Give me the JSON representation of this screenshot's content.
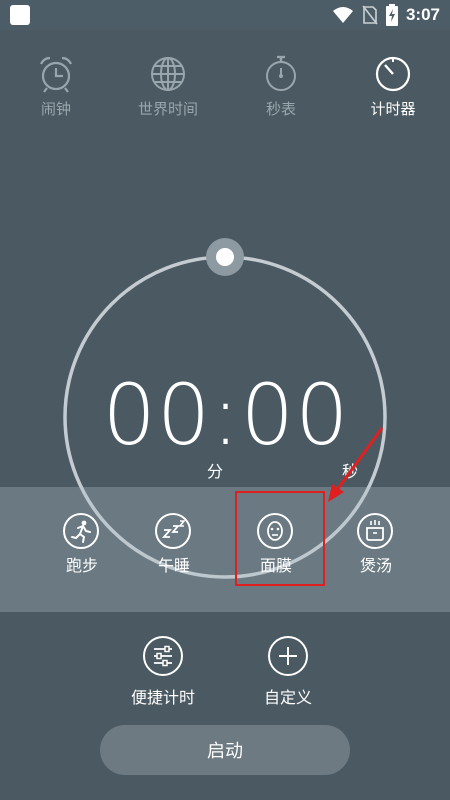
{
  "status_bar": {
    "time": "3:07"
  },
  "tabs": [
    {
      "label": "闹钟",
      "icon": "alarm-clock-icon",
      "active": false
    },
    {
      "label": "世界时间",
      "icon": "globe-icon",
      "active": false
    },
    {
      "label": "秒表",
      "icon": "stopwatch-icon",
      "active": false
    },
    {
      "label": "计时器",
      "icon": "timer-icon",
      "active": true
    }
  ],
  "timer": {
    "display": "00:00",
    "unit_minutes": "分",
    "unit_seconds": "秒"
  },
  "presets": [
    {
      "label": "跑步",
      "icon": "running-icon"
    },
    {
      "label": "午睡",
      "icon": "sleep-zzz-icon"
    },
    {
      "label": "面膜",
      "icon": "face-mask-icon"
    },
    {
      "label": "煲汤",
      "icon": "soup-pot-icon"
    }
  ],
  "actions": [
    {
      "label": "便捷计时",
      "icon": "sliders-icon"
    },
    {
      "label": "自定义",
      "icon": "plus-icon"
    }
  ],
  "start_button": {
    "label": "启动"
  },
  "colors": {
    "background": "#4a5962",
    "band": "#7c8a92",
    "highlight": "#e02020",
    "inactive_text": "#9aa6ad"
  }
}
